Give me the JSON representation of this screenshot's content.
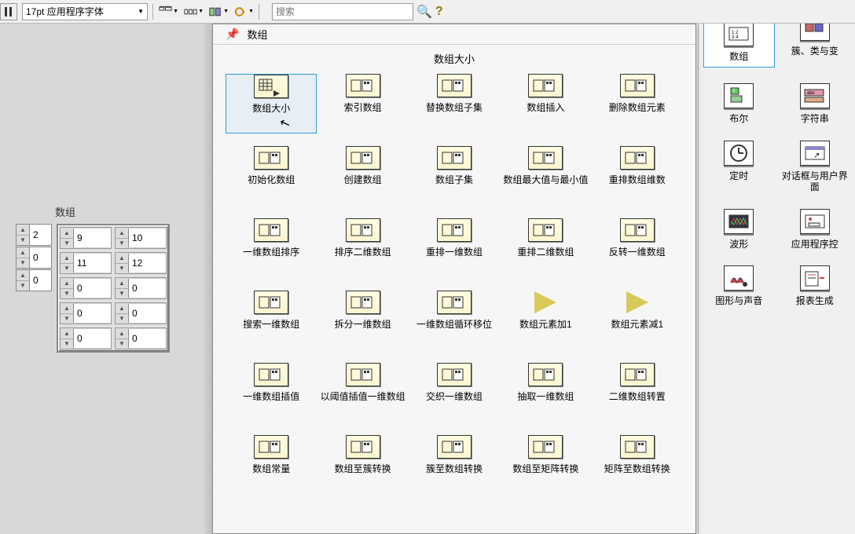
{
  "toolbar": {
    "font_label": "17pt 应用程序字体",
    "search_placeholder": "搜索"
  },
  "array_widget": {
    "title": "数组",
    "index": [
      "2",
      "0",
      "0"
    ],
    "grid": [
      [
        "9",
        "10"
      ],
      [
        "11",
        "12"
      ],
      [
        "0",
        "0"
      ],
      [
        "0",
        "0"
      ],
      [
        "0",
        "0"
      ]
    ]
  },
  "palette": {
    "title": "数组",
    "subtitle": "数组大小",
    "items": [
      {
        "label": "数组大小",
        "icon": "grid-arrow"
      },
      {
        "label": "索引数组",
        "icon": "index-arr"
      },
      {
        "label": "替换数组子集",
        "icon": "replace-sub"
      },
      {
        "label": "数组插入",
        "icon": "insert-arr"
      },
      {
        "label": "删除数组元素",
        "icon": "delete-elem"
      },
      {
        "label": "初始化数组",
        "icon": "init-arr"
      },
      {
        "label": "创建数组",
        "icon": "build-arr"
      },
      {
        "label": "数组子集",
        "icon": "subset"
      },
      {
        "label": "数组最大值与最小值",
        "icon": "maxmin"
      },
      {
        "label": "重排数组维数",
        "icon": "reshape"
      },
      {
        "label": "一维数组排序",
        "icon": "sort1d"
      },
      {
        "label": "排序二维数组",
        "icon": "sort2d"
      },
      {
        "label": "重排一维数组",
        "icon": "perm1d"
      },
      {
        "label": "重排二维数组",
        "icon": "perm2d"
      },
      {
        "label": "反转一维数组",
        "icon": "reverse"
      },
      {
        "label": "搜索一维数组",
        "icon": "search1d"
      },
      {
        "label": "拆分一维数组",
        "icon": "split1d"
      },
      {
        "label": "一维数组循环移位",
        "icon": "rotate"
      },
      {
        "label": "数组元素加1",
        "icon": "inc",
        "tri": true
      },
      {
        "label": "数组元素减1",
        "icon": "dec",
        "tri": true
      },
      {
        "label": "一维数组插值",
        "icon": "interp"
      },
      {
        "label": "以阈值插值一维数组",
        "icon": "thresh"
      },
      {
        "label": "交织一维数组",
        "icon": "interleave"
      },
      {
        "label": "抽取一维数组",
        "icon": "decimate"
      },
      {
        "label": "二维数组转置",
        "icon": "transpose"
      },
      {
        "label": "数组常量",
        "icon": "const"
      },
      {
        "label": "数组至簇转换",
        "icon": "to-cluster"
      },
      {
        "label": "簇至数组转换",
        "icon": "to-array"
      },
      {
        "label": "数组至矩阵转换",
        "icon": "to-matrix"
      },
      {
        "label": "矩阵至数组转换",
        "icon": "from-matrix"
      }
    ]
  },
  "right_panel": {
    "items": [
      {
        "label": "数组",
        "selected": true
      },
      {
        "label": "簇、类与变"
      },
      {
        "label": "布尔"
      },
      {
        "label": "字符串"
      },
      {
        "label": "定时"
      },
      {
        "label": "对话框与用户界面"
      },
      {
        "label": "波形"
      },
      {
        "label": "应用程序控"
      },
      {
        "label": "图形与声音"
      },
      {
        "label": "报表生成"
      }
    ]
  }
}
